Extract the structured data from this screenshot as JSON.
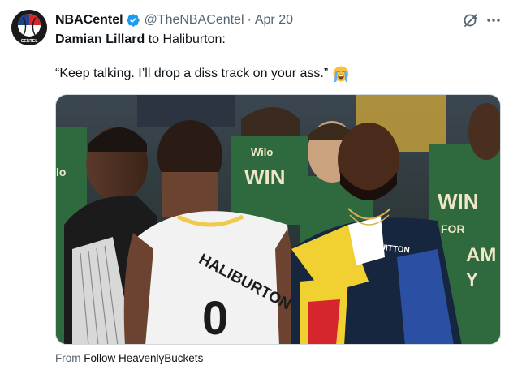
{
  "author": {
    "display_name": "NBACentel",
    "handle": "@TheNBACentel",
    "separator": "·",
    "date": "Apr 20",
    "avatar_text": "CENTEL"
  },
  "tweet": {
    "line1_mention": "Damian Lillard",
    "line1_rest": " to Haliburton:",
    "line2_text": "“Keep talking. I’ll drop a diss track on your ass.”",
    "emoji": "loudly-crying-face"
  },
  "media": {
    "jersey_name": "HALIBURTON",
    "jersey_number": "0",
    "shirt_brand": "VUITTON",
    "bg_jersey_1": "WIN",
    "bg_jersey_2": "Wilo",
    "bg_jersey_3": "WIN FOR AM Y"
  },
  "source": {
    "prefix": "From ",
    "name": "Follow HeavenlyBuckets"
  },
  "colors": {
    "verified": "#1d9bf0",
    "text_secondary": "#536471",
    "bucks_green": "#2f6a3e",
    "pacers_yellow": "#f2c94c"
  },
  "icons": [
    "verified-badge-icon",
    "grok-icon",
    "more-icon",
    "loudly-crying-face-emoji"
  ]
}
